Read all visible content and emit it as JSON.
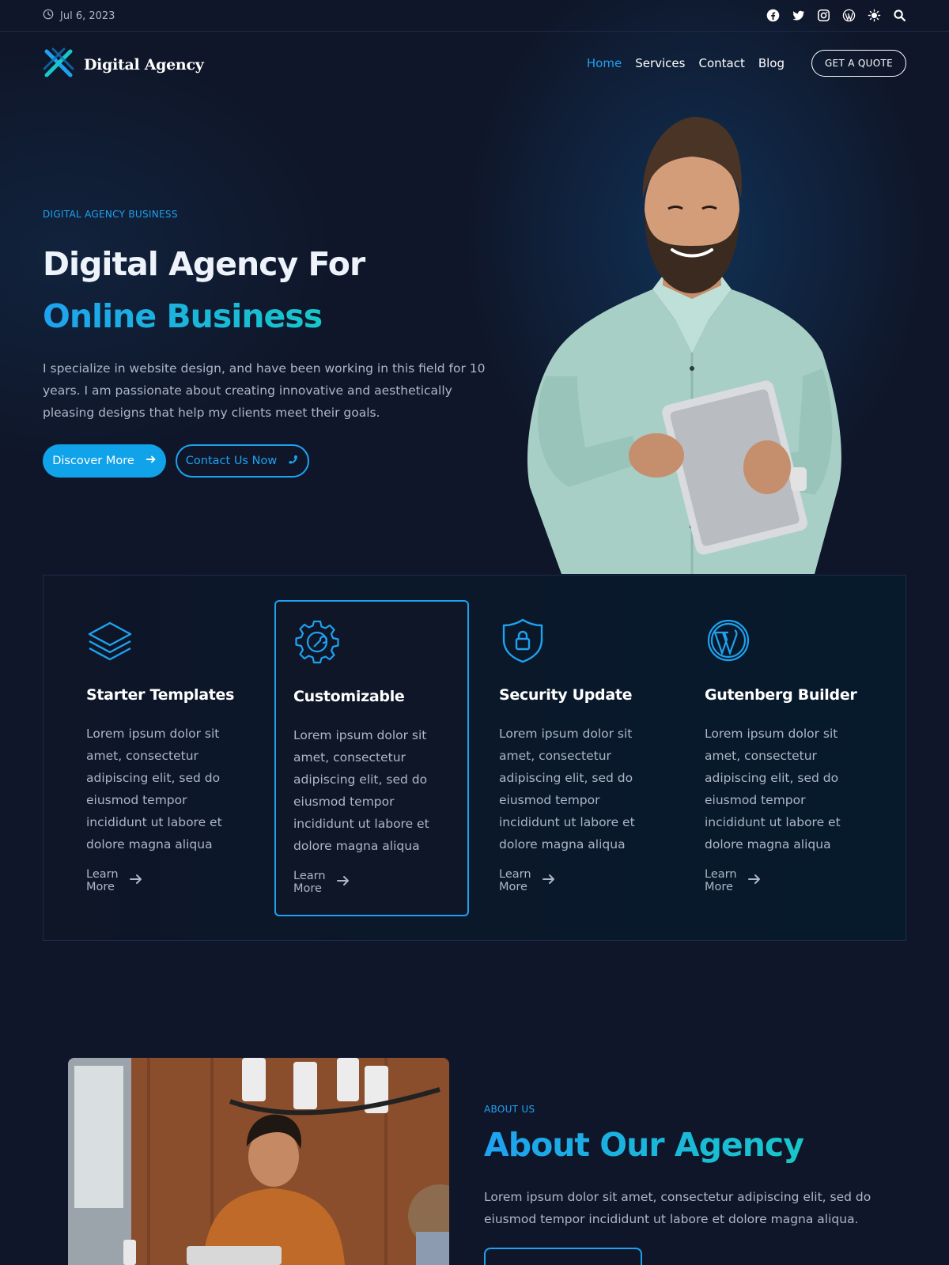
{
  "topbar": {
    "date": "Jul 6, 2023",
    "social_icons": [
      "facebook-icon",
      "twitter-icon",
      "instagram-icon",
      "wordpress-icon",
      "theme-toggle-icon",
      "search-icon"
    ]
  },
  "header": {
    "logo_text": "Digital Agency",
    "nav": [
      {
        "label": "Home",
        "active": true
      },
      {
        "label": "Services",
        "active": false
      },
      {
        "label": "Contact",
        "active": false
      },
      {
        "label": "Blog",
        "active": false
      }
    ],
    "quote_button": "GET A QUOTE"
  },
  "hero": {
    "eyebrow": "DIGITAL AGENCY BUSINESS",
    "title_line1": "Digital Agency For",
    "title_line2": "Online Business",
    "description": "I specialize in website design, and have been working in this field for 10 years. I am passionate about creating innovative and aesthetically pleasing designs that help my clients meet their goals.",
    "primary_button": "Discover More",
    "secondary_button": "Contact Us Now"
  },
  "features": [
    {
      "icon": "layers-icon",
      "title": "Starter Templates",
      "text": "Lorem ipsum dolor sit amet, consectetur adipiscing elit, sed do eiusmod tempor incididunt ut labore et dolore magna aliqua",
      "link": "Learn More"
    },
    {
      "icon": "gear-icon",
      "title": "Customizable",
      "text": "Lorem ipsum dolor sit amet, consectetur adipiscing elit, sed do eiusmod tempor incididunt ut labore et dolore magna aliqua",
      "link": "Learn More"
    },
    {
      "icon": "shield-lock-icon",
      "title": "Security Update",
      "text": "Lorem ipsum dolor sit amet, consectetur adipiscing elit, sed do eiusmod tempor incididunt ut labore et dolore magna aliqua",
      "link": "Learn More"
    },
    {
      "icon": "wordpress-icon",
      "title": "Gutenberg Builder",
      "text": "Lorem ipsum dolor sit amet, consectetur adipiscing elit, sed do eiusmod tempor incididunt ut labore et dolore magna aliqua",
      "link": "Learn More"
    }
  ],
  "about": {
    "eyebrow": "ABOUT US",
    "title": "About Our Agency",
    "description": "Lorem ipsum dolor sit amet, consectetur adipiscing elit, sed do eiusmod tempor incididunt ut labore et dolore magna aliqua."
  },
  "colors": {
    "accent": "#1ea2f0",
    "accent_teal": "#18c7c9",
    "background": "#0f1629",
    "muted_text": "#aeb6c8"
  }
}
